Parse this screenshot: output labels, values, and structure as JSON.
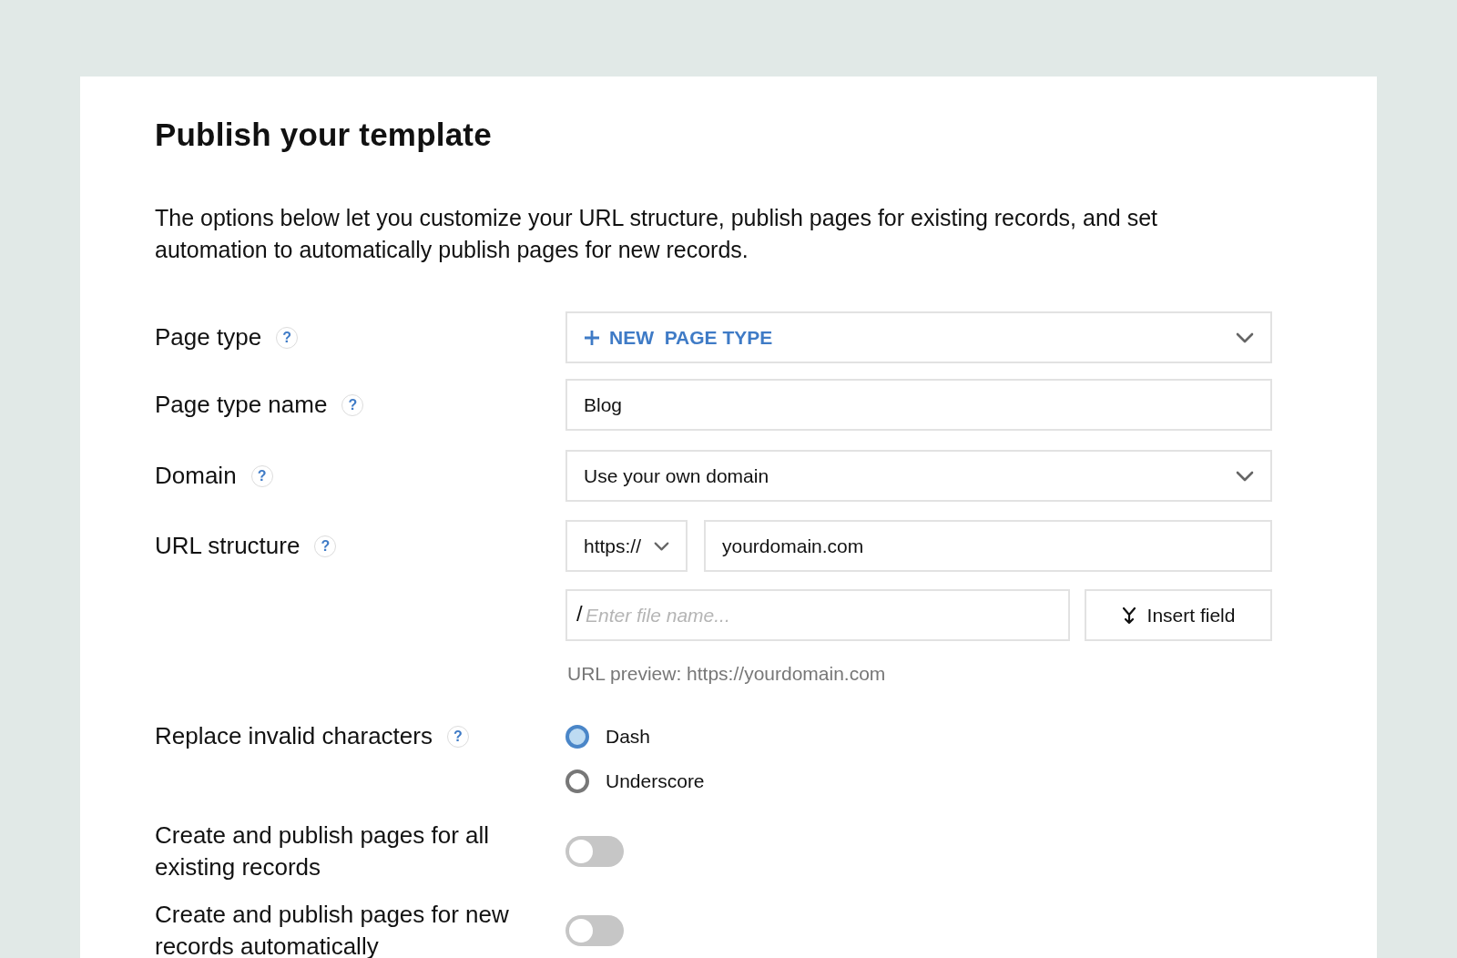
{
  "title": "Publish your template",
  "description": "The options below let you customize your URL structure, publish pages for existing records, and set automation to automatically publish pages for new records.",
  "rows": [
    {
      "kind": "select",
      "label": "Page type",
      "help": "?",
      "value": "NEW  PAGE TYPE",
      "action": true
    },
    {
      "kind": "text",
      "label": "Page type name",
      "help": "?",
      "value": "Blog"
    },
    {
      "kind": "select",
      "label": "Domain",
      "help": "?",
      "value": "Use your own domain",
      "action": false
    },
    {
      "kind": "url",
      "label": "URL structure",
      "help": "?",
      "protocol": "https://",
      "domain": "yourdomain.com",
      "prefix": "/",
      "placeholder": "Enter file name...",
      "button": "Insert field",
      "preview": "URL preview: https://yourdomain.com"
    },
    {
      "kind": "radio",
      "label": "Replace invalid characters",
      "help": "?",
      "options": [
        {
          "label": "Dash",
          "selected": true
        },
        {
          "label": "Underscore",
          "selected": false
        }
      ]
    },
    {
      "kind": "toggle",
      "label": "Create and publish pages for all existing records",
      "on": false
    },
    {
      "kind": "toggle",
      "label": "Create and publish pages for new records automatically",
      "on": false
    }
  ]
}
